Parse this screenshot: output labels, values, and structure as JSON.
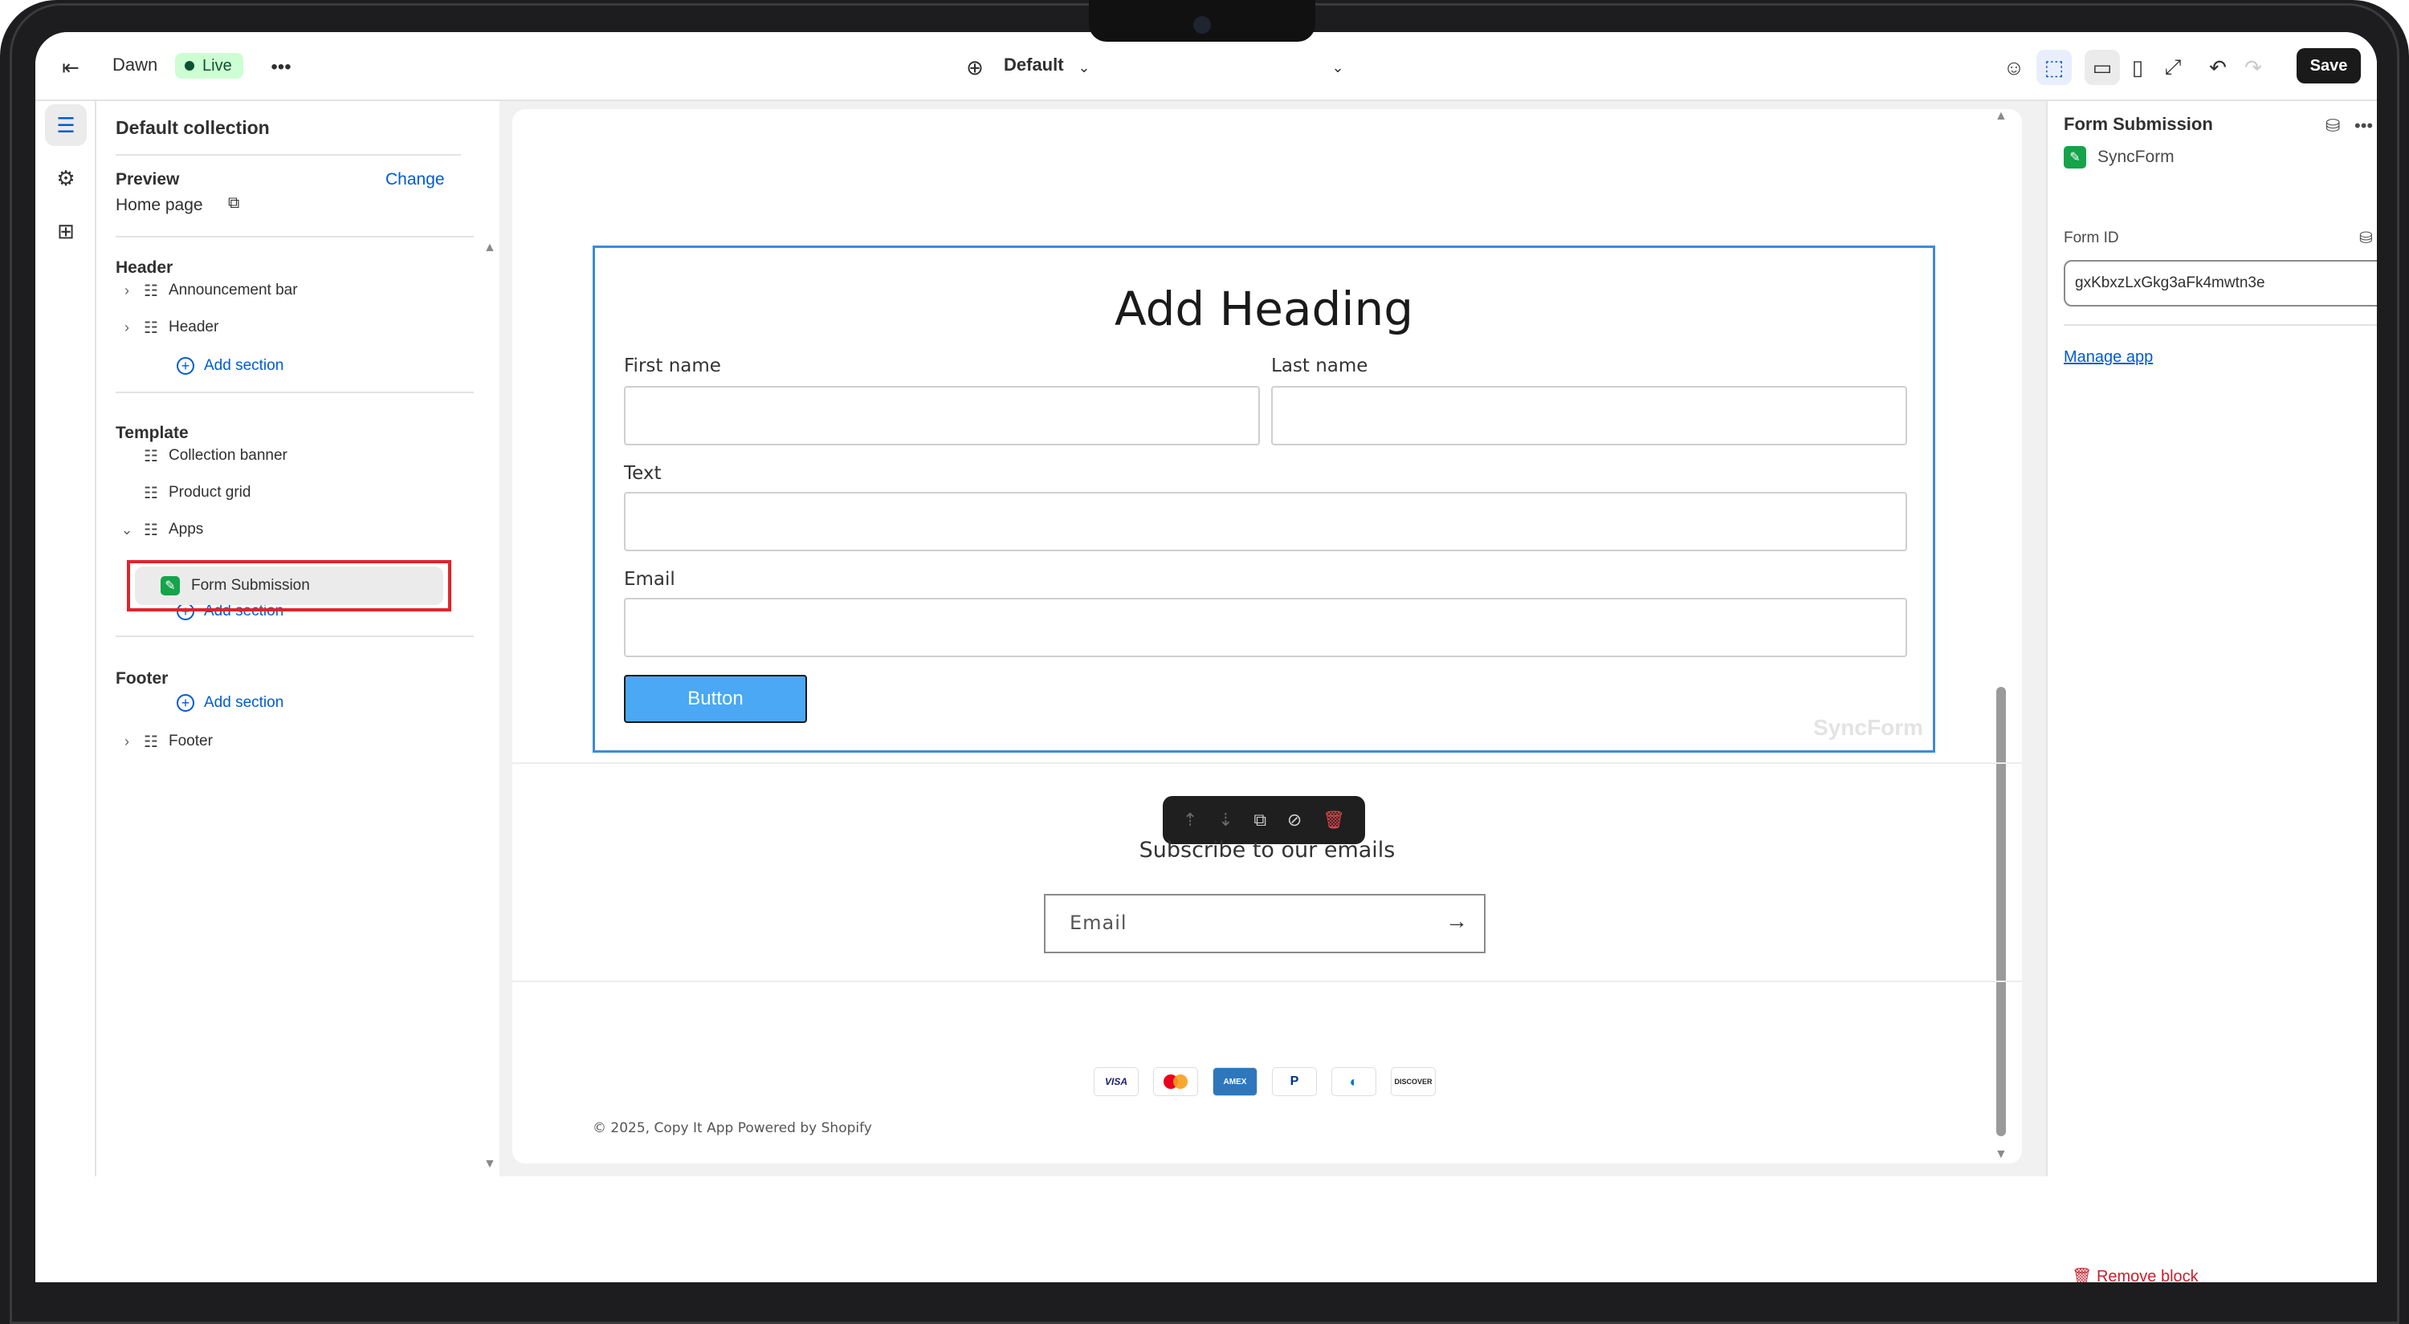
{
  "topbar": {
    "theme_name": "Dawn",
    "status_badge": "Live",
    "more_icon": "ellipsis-icon",
    "template_selector": "Default",
    "save_label": "Save"
  },
  "sidebar": {
    "title": "Default collection",
    "preview_label": "Preview",
    "preview_page": "Home page",
    "change_link": "Change",
    "header_group": {
      "title": "Header",
      "items": [
        "Announcement bar",
        "Header"
      ],
      "add_section": "Add section"
    },
    "template_group": {
      "title": "Template",
      "items": [
        "Collection banner",
        "Product grid",
        "Apps"
      ],
      "selected_block": "Form Submission",
      "add_section": "Add section"
    },
    "footer_group": {
      "title": "Footer",
      "add_section": "Add section",
      "items": [
        "Footer"
      ]
    }
  },
  "preview": {
    "form": {
      "heading": "Add Heading",
      "first_name_label": "First name",
      "last_name_label": "Last name",
      "text_label": "Text",
      "email_label": "Email",
      "button_label": "Button",
      "watermark": "SyncForm"
    },
    "newsletter": {
      "title": "Subscribe to our emails",
      "email_placeholder": "Email"
    },
    "payment_icons": [
      "VISA",
      "Mastercard",
      "AMEX",
      "PayPal",
      "Diners Club",
      "DISCOVER"
    ],
    "copyright": "© 2025, Copy It App Powered by Shopify"
  },
  "right_panel": {
    "title": "Form Submission",
    "app_name": "SyncForm",
    "form_id_label": "Form ID",
    "form_id_value": "gxKbxzLxGkg3aFk4mwtn3e",
    "manage_app_link": "Manage app",
    "remove_block": "Remove block"
  },
  "colors": {
    "accent_link": "#005bd3",
    "live_badge_bg": "#cdfed3",
    "selection_outline": "#e0242a",
    "form_border": "#3d8bd9",
    "form_button": "#4aa8f5"
  }
}
